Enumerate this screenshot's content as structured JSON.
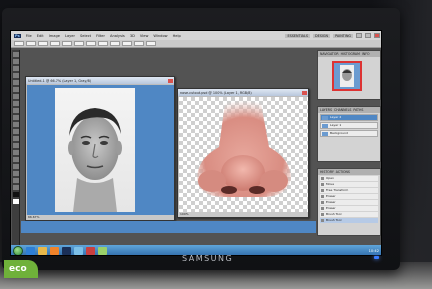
{
  "app": {
    "logo": "Ps",
    "menu": [
      "File",
      "Edit",
      "Image",
      "Layer",
      "Select",
      "Filter",
      "Analysis",
      "3D",
      "View",
      "Window",
      "Help"
    ],
    "workspace_buttons": [
      "ESSENTIALS",
      "DESIGN",
      "PAINTING"
    ]
  },
  "documents": [
    {
      "title": "Untitled-1 @ 66.7% (Layer 1, Gray/8)",
      "status": "66.67%"
    },
    {
      "title": "nose-cutout.psd @ 100% (Layer 1, RGB/8)",
      "status": "100%"
    }
  ],
  "panels": {
    "navigator": {
      "tabs": [
        "NAVIGATOR",
        "HISTOGRAM",
        "INFO"
      ]
    },
    "layers": {
      "tabs": [
        "LAYERS",
        "CHANNELS",
        "PATHS"
      ],
      "rows": [
        "Layer 2",
        "Layer 1",
        "Background"
      ]
    },
    "history": {
      "tabs": [
        "HISTORY",
        "ACTIONS"
      ],
      "rows": [
        "Open",
        "Move",
        "Free Transform",
        "Eraser",
        "Eraser",
        "Eraser",
        "Brush Tool",
        "Brush Tool"
      ]
    }
  },
  "monitor": {
    "brand": "SAMSUNG",
    "eco_label": "eco"
  },
  "taskbar": {
    "icons": [
      "ie-icon",
      "folder-icon",
      "media-icon",
      "photoshop-icon",
      "app-icon",
      "app-icon",
      "app-icon"
    ],
    "tray_clock": "10:42"
  },
  "colors": {
    "canvas_blue": "#4f87c4",
    "ps_ui_gray": "#535353",
    "taskbar_blue": "#3a82c4",
    "eco_green": "#6fb13a"
  }
}
